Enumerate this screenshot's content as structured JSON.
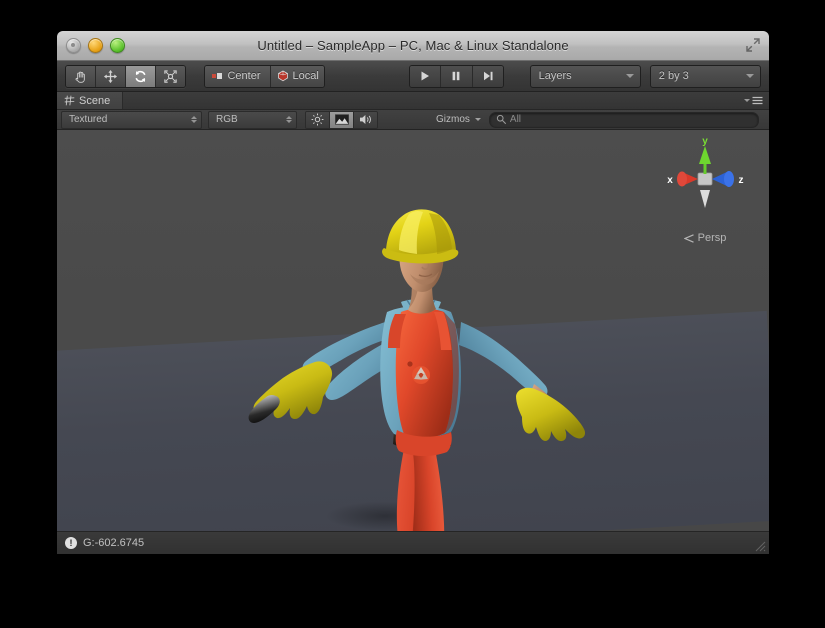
{
  "window": {
    "title": "Untitled – SampleApp – PC, Mac & Linux Standalone",
    "traffic_lights": {
      "close_label": "close",
      "minimize_label": "minimize",
      "zoom_label": "zoom"
    },
    "fullscreen_label": "Enter Full Screen"
  },
  "toolbar": {
    "transform_tools": [
      {
        "name": "hand-tool",
        "label": "Hand Tool",
        "active": false
      },
      {
        "name": "move-tool",
        "label": "Move Tool",
        "active": false
      },
      {
        "name": "rotate-tool",
        "label": "Rotate Tool",
        "active": true
      },
      {
        "name": "scale-tool",
        "label": "Scale Tool",
        "active": false
      }
    ],
    "pivot_label": "Center",
    "rotation_label": "Local",
    "play_label": "Play",
    "pause_label": "Pause",
    "step_label": "Step",
    "layers_label": "Layers",
    "layout_label": "2 by 3"
  },
  "scene_panel": {
    "tab_label": "Scene",
    "panel_menu_label": "Panel Options",
    "draw_mode": "Textured",
    "color_mode": "RGB",
    "toggles": [
      {
        "name": "scene-lighting-toggle",
        "label": "Lighting",
        "active": false
      },
      {
        "name": "scene-skybox-toggle",
        "label": "Skybox / Effects",
        "active": true
      },
      {
        "name": "scene-audio-toggle",
        "label": "Audio",
        "active": false
      }
    ],
    "gizmos_label": "Gizmos",
    "search_value": "All",
    "search_placeholder": "Search"
  },
  "viewport": {
    "axis_gizmo": {
      "x_label": "x",
      "y_label": "y",
      "z_label": "z",
      "x_color": "#d93b2b",
      "y_color": "#5ecc2a",
      "z_color": "#2a64d9",
      "projection_label": "Persp"
    },
    "scene_object": {
      "name": "Construction Worker Character",
      "helmet_color": "#e8d81c",
      "shirt_color": "#6fa8bf",
      "overalls_color": "#e2482a",
      "glove_color": "#d4cc1e",
      "belt_color": "#2e2824",
      "skin_color": "#c99a7c",
      "boot_color": "#241f1d"
    },
    "background_color": "#4a4a4a",
    "ground_color": "#454852"
  },
  "statusbar": {
    "icon_label": "error",
    "message": "G:-602.6745"
  }
}
